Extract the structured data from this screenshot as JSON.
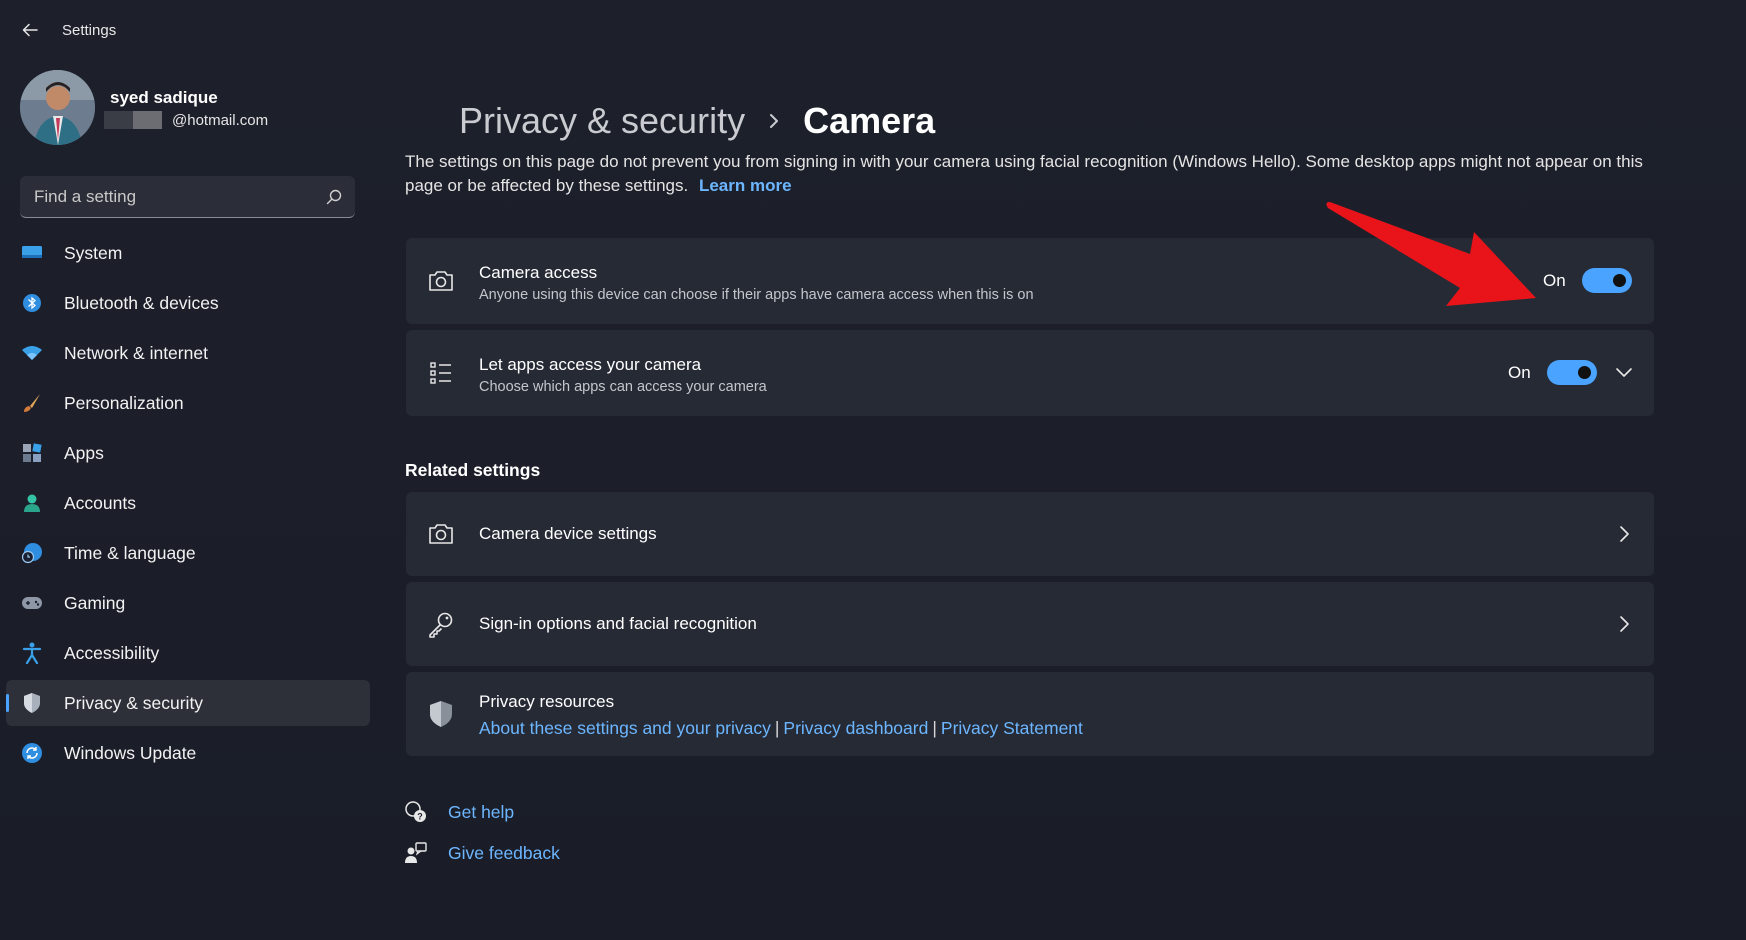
{
  "window": {
    "title": "Settings"
  },
  "profile": {
    "name": "syed sadique",
    "email": "@hotmail.com"
  },
  "search": {
    "placeholder": "Find a setting"
  },
  "sidebar": {
    "items": [
      {
        "label": "System",
        "icon": "system-icon"
      },
      {
        "label": "Bluetooth & devices",
        "icon": "bluetooth-icon"
      },
      {
        "label": "Network & internet",
        "icon": "wifi-icon"
      },
      {
        "label": "Personalization",
        "icon": "brush-icon"
      },
      {
        "label": "Apps",
        "icon": "apps-icon"
      },
      {
        "label": "Accounts",
        "icon": "accounts-icon"
      },
      {
        "label": "Time & language",
        "icon": "time-language-icon"
      },
      {
        "label": "Gaming",
        "icon": "gamepad-icon"
      },
      {
        "label": "Accessibility",
        "icon": "accessibility-icon"
      },
      {
        "label": "Privacy & security",
        "icon": "shield-icon",
        "active": true
      },
      {
        "label": "Windows Update",
        "icon": "update-icon"
      }
    ]
  },
  "breadcrumb": {
    "parent": "Privacy & security",
    "current": "Camera"
  },
  "description": {
    "text": "The settings on this page do not prevent you from signing in with your camera using facial recognition (Windows Hello). Some desktop apps might not appear on this page or be affected by these settings.",
    "link": "Learn more"
  },
  "camera_access": {
    "title": "Camera access",
    "subtitle": "Anyone using this device can choose if their apps have camera access when this is on",
    "toggle_label": "On"
  },
  "apps_access": {
    "title": "Let apps access your camera",
    "subtitle": "Choose which apps can access your camera",
    "toggle_label": "On"
  },
  "related": {
    "heading": "Related settings",
    "camera_device": "Camera device settings",
    "signin": "Sign-in options and facial recognition",
    "privacy_resources": {
      "title": "Privacy resources",
      "link1": "About these settings and your privacy",
      "link2": "Privacy dashboard",
      "link3": "Privacy Statement",
      "separator": "|"
    }
  },
  "help": {
    "get_help": "Get help",
    "feedback": "Give feedback"
  },
  "colors": {
    "accent": "#4aa3ff",
    "link": "#6cb6ff",
    "annotation_arrow": "#e8141a"
  }
}
